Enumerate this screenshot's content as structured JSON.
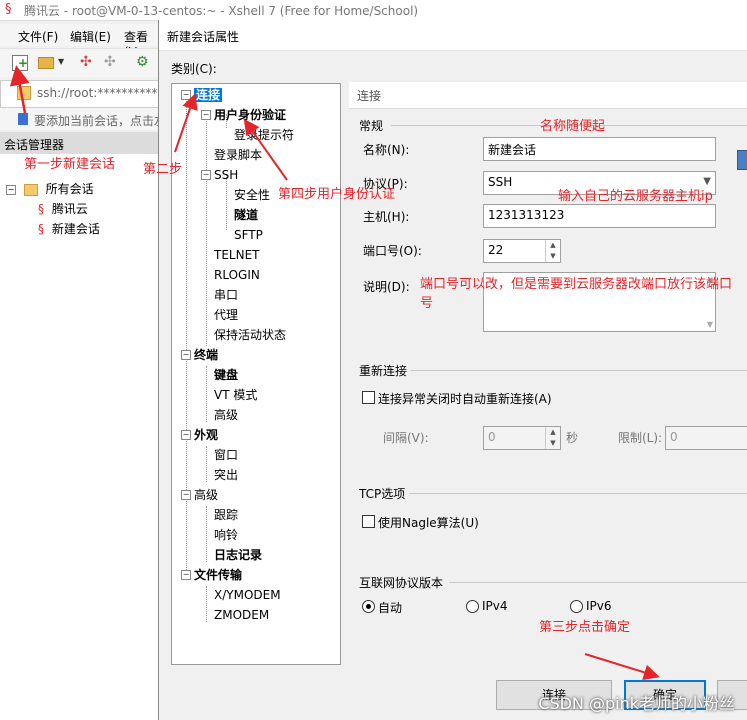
{
  "background_window": {
    "title": "腾讯云 - root@VM-0-13-centos:~ - Xshell 7 (Free for Home/School)",
    "menu": [
      "文件(F)",
      "编辑(E)",
      "查看(V"
    ],
    "address": "ssh://root:**********",
    "hint": "要添加当前会话，点击左",
    "session_manager_title": "会话管理器",
    "tree": [
      "所有会话",
      "腾讯云",
      "新建会话"
    ]
  },
  "dialog": {
    "title": "新建会话属性",
    "category_label": "类别(C):",
    "tree": {
      "connection": "连接",
      "user_auth": "用户身份验证",
      "login_prompt": "登录提示符",
      "login_script": "登录脚本",
      "ssh": "SSH",
      "security": "安全性",
      "tunnel": "隧道",
      "sftp": "SFTP",
      "telnet": "TELNET",
      "rlogin": "RLOGIN",
      "serial": "串口",
      "proxy": "代理",
      "keepalive": "保持活动状态",
      "terminal": "终端",
      "keyboard": "键盘",
      "vt_mode": "VT 模式",
      "advanced_term": "高级",
      "appearance": "外观",
      "window": "窗口",
      "highlight": "突出",
      "advanced": "高级",
      "trace": "跟踪",
      "bell": "响铃",
      "logging": "日志记录",
      "file_transfer": "文件传输",
      "xymodem": "X/YMODEM",
      "zmodem": "ZMODEM"
    },
    "header": "连接",
    "general": {
      "section": "常规",
      "name_label": "名称(N):",
      "name_value": "新建会话",
      "protocol_label": "协议(P):",
      "protocol_value": "SSH",
      "host_label": "主机(H):",
      "host_value": "1231313123",
      "port_label": "端口号(O):",
      "port_value": "22",
      "desc_label": "说明(D):"
    },
    "reconnect": {
      "section": "重新连接",
      "checkbox_label": "连接异常关闭时自动重新连接(A)",
      "interval_label": "间隔(V):",
      "interval_value": "0",
      "seconds": "秒",
      "limit_label": "限制(L):",
      "limit_value": "0"
    },
    "tcp": {
      "section": "TCP选项",
      "nagle_label": "使用Nagle算法(U)"
    },
    "ip_version": {
      "section": "互联网协议版本",
      "options": [
        "自动",
        "IPv4",
        "IPv6"
      ],
      "selected": "自动"
    },
    "buttons": {
      "connect": "连接",
      "ok": "确定"
    }
  },
  "annotations": {
    "step1": "第一步新建会话",
    "step2": "第二步",
    "step3": "第三步点击确定",
    "step4": "第四步用户身份认证",
    "name_tip": "名称随便起",
    "host_tip": "输入自己的云服务器主机ip",
    "port_tip": "端口号可以改，但是需要到云服务器改端口放行该端口号"
  },
  "watermark": "CSDN @pink老师的小粉丝",
  "colors": {
    "annotation": "#e4252a",
    "selection": "#0078d7"
  }
}
